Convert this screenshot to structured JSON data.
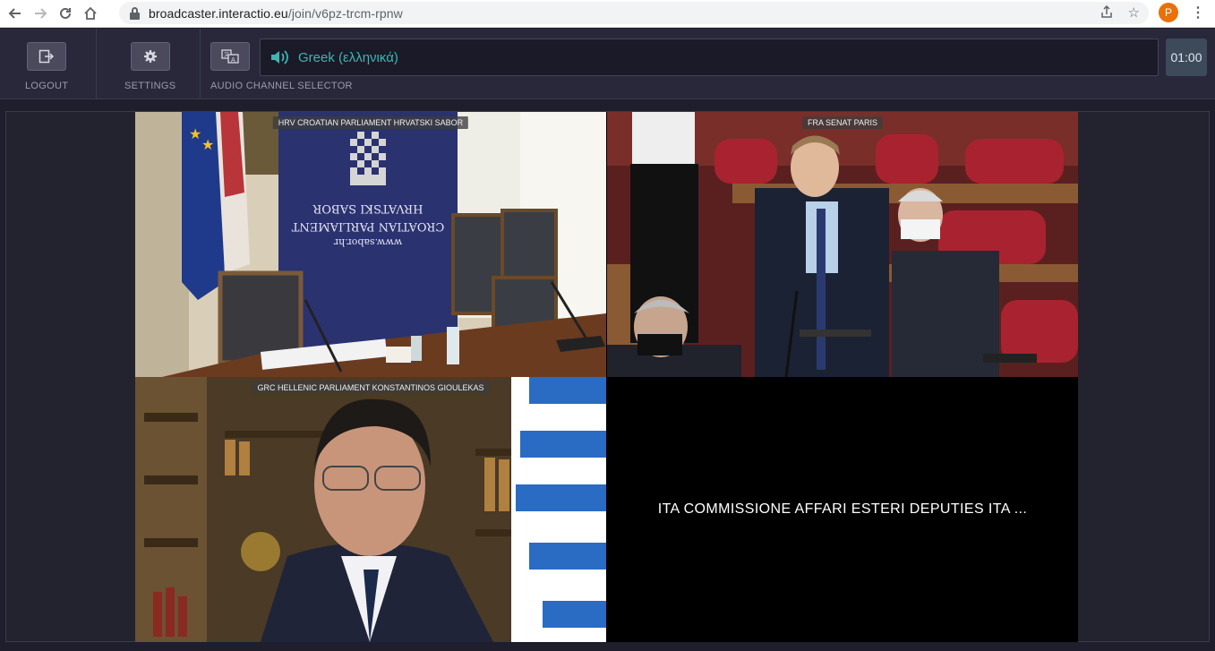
{
  "browser": {
    "url_host": "broadcaster.interactio.eu",
    "url_path": "/join/v6pz-trcm-rpnw",
    "profile_initial": "P"
  },
  "toolbar": {
    "logout_label": "LOGOUT",
    "settings_label": "SETTINGS",
    "audio_label": "AUDIO CHANNEL SELECTOR",
    "channel_name": "Greek (ελληνικά)",
    "timer": "01:00"
  },
  "tiles": [
    {
      "label": "HRV CROATIAN PARLIAMENT HRVATSKI SABOR",
      "banner_lines": [
        "HRVATSKI SABOR",
        "CROATIAN PARLIAMENT",
        "www.sabor.hr"
      ]
    },
    {
      "label": "FRA SENAT PARIS"
    },
    {
      "label": "GRC HELLENIC PARLIAMENT KONSTANTINOS GIOULEKAS"
    },
    {
      "label": "ITA COMMISSIONE AFFARI ESTERI DEPUTIES ITA ..."
    }
  ],
  "colors": {
    "accent": "#3fb5b0",
    "toolbar_bg": "#28283a",
    "stage_bg": "#23232f"
  }
}
